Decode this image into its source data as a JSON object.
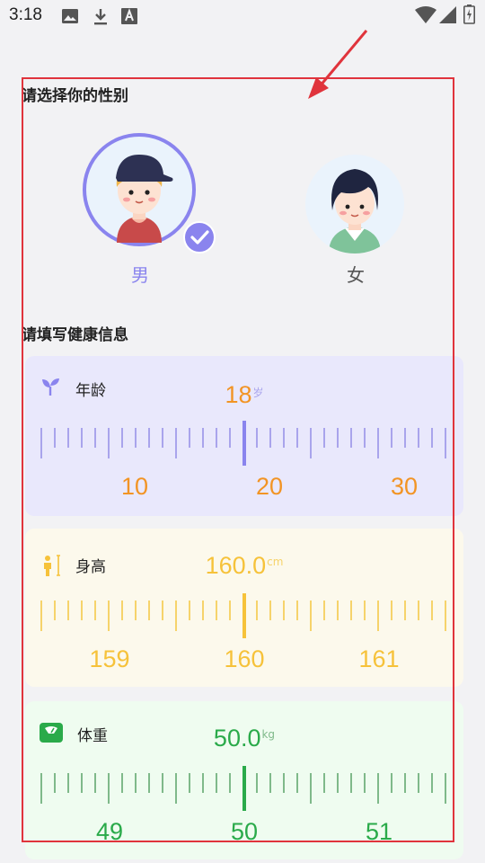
{
  "status_bar": {
    "time": "3:18",
    "left_icons": [
      "image-icon",
      "download-icon",
      "font-icon"
    ],
    "right_icons": [
      "wifi-icon",
      "signal-icon",
      "battery-icon"
    ]
  },
  "gender_section": {
    "title": "请选择你的性别",
    "male_label": "男",
    "female_label": "女",
    "selected": "male"
  },
  "health_section": {
    "title": "请填写健康信息"
  },
  "age": {
    "label": "年龄",
    "value": "18",
    "unit": "岁",
    "ticks": [
      "10",
      "20",
      "30"
    ],
    "accent": "#f29424",
    "ruler_color": "#a9a4ec",
    "bg": "#e9e8fc"
  },
  "height": {
    "label": "身高",
    "value": "160.0",
    "unit": "cm",
    "ticks": [
      "159",
      "160",
      "161"
    ],
    "accent": "#f6c23a",
    "ruler_color": "#f6d36b",
    "bg": "#fcf9ec"
  },
  "weight": {
    "label": "体重",
    "value": "50.0",
    "unit": "kg",
    "ticks": [
      "49",
      "50",
      "51"
    ],
    "accent": "#2aaa4a",
    "ruler_color": "#7fb98a",
    "bg": "#effcf0"
  },
  "colors": {
    "male_ring": "#8a84ee",
    "annotation": "#e0343c"
  }
}
